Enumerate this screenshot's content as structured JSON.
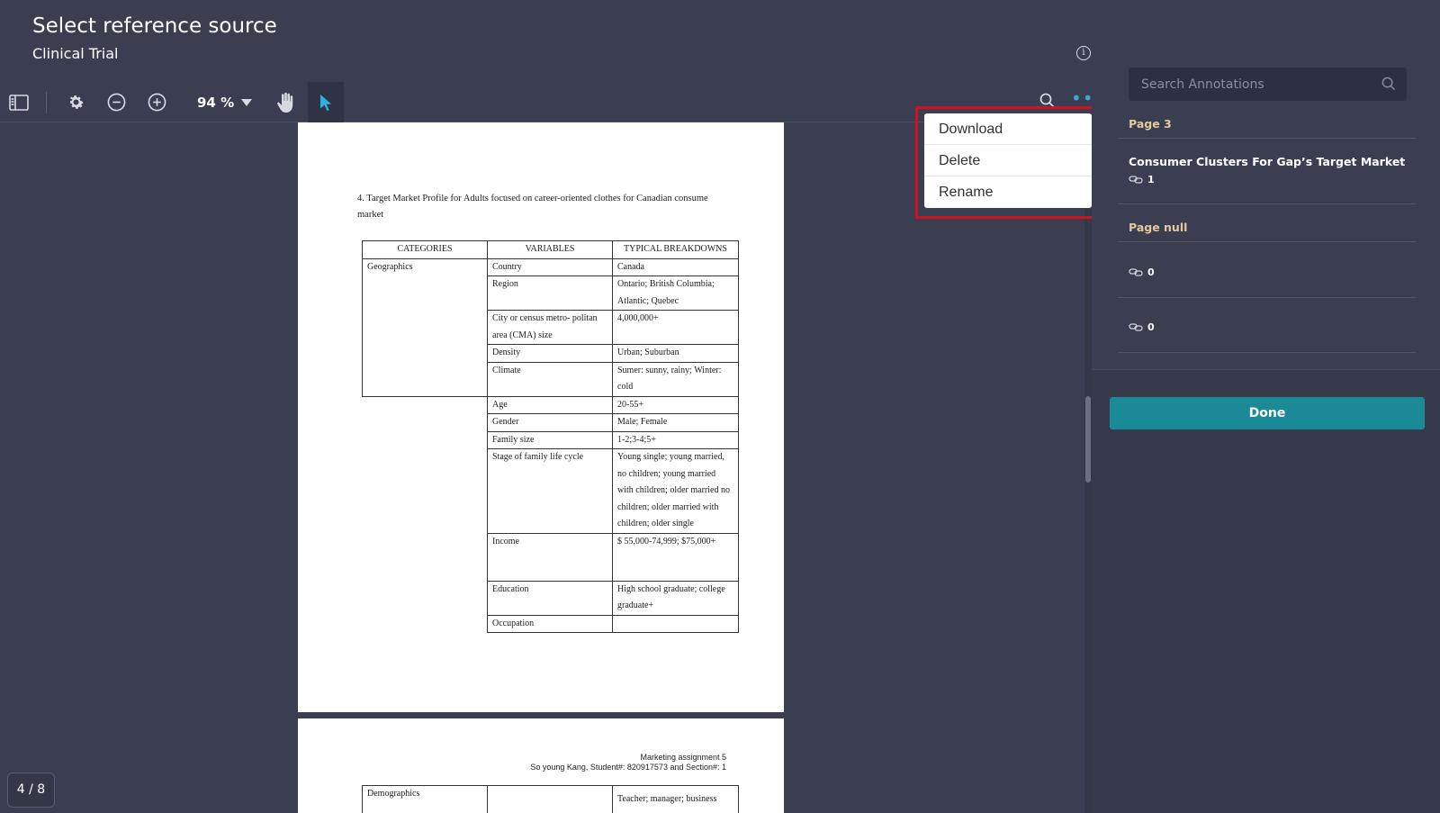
{
  "header": {
    "title": "Select reference source",
    "subtitle": "Clinical Trial"
  },
  "toolbar": {
    "zoom": "94 %"
  },
  "document": {
    "page1_heading": "4. Target Market Profile for Adults focused on career-oriented clothes for Canadian consume market",
    "table_headers": [
      "CATEGORIES",
      "VARIABLES",
      "TYPICAL BREAKDOWNS"
    ],
    "geographics": "Geographics",
    "rows": [
      {
        "v": "Country",
        "b": "Canada"
      },
      {
        "v": "Region",
        "b": "Ontario; British Columbia; Atlantic; Quebec"
      },
      {
        "v": "City or census metro- politan area (CMA) size",
        "b": "4,000,000+"
      },
      {
        "v": "Density",
        "b": "Urban; Suburban"
      },
      {
        "v": "Climate",
        "b": "Sumer: sunny, rainy; Winter: cold"
      },
      {
        "v": "Age",
        "b": "20-55+"
      },
      {
        "v": "Gender",
        "b": "Male; Female"
      },
      {
        "v": "Family size",
        "b": "1-2;3-4;5+"
      },
      {
        "v": "Stage of family life cycle",
        "b": "Young single; young married, no children; young married with children; older married no children; older married with children; older single"
      },
      {
        "v": "Income",
        "b": "$ 55,000-74,999; $75,000+"
      },
      {
        "v": "Education",
        "b": "High school graduate; college graduate+"
      },
      {
        "v": "Occupation",
        "b": ""
      }
    ],
    "page2_header_line1": "Marketing assignment 5",
    "page2_header_line2": "So young Kang, Student#: 820917573 and Section#: 1",
    "page2_cat": "Demographics",
    "page2_breakdown": "Teacher; manager; business"
  },
  "menu": {
    "download": "Download",
    "delete": "Delete",
    "rename": "Rename"
  },
  "panel": {
    "search_placeholder": "Search Annotations",
    "page3_label": "Page 3",
    "ann1_title": "Consumer Clusters For Gap’s Target Market",
    "ann1_count": "1",
    "pagenull_label": "Page null",
    "ann2_count": "0",
    "ann3_count": "0",
    "done": "Done"
  },
  "page_counter": "4 / 8"
}
